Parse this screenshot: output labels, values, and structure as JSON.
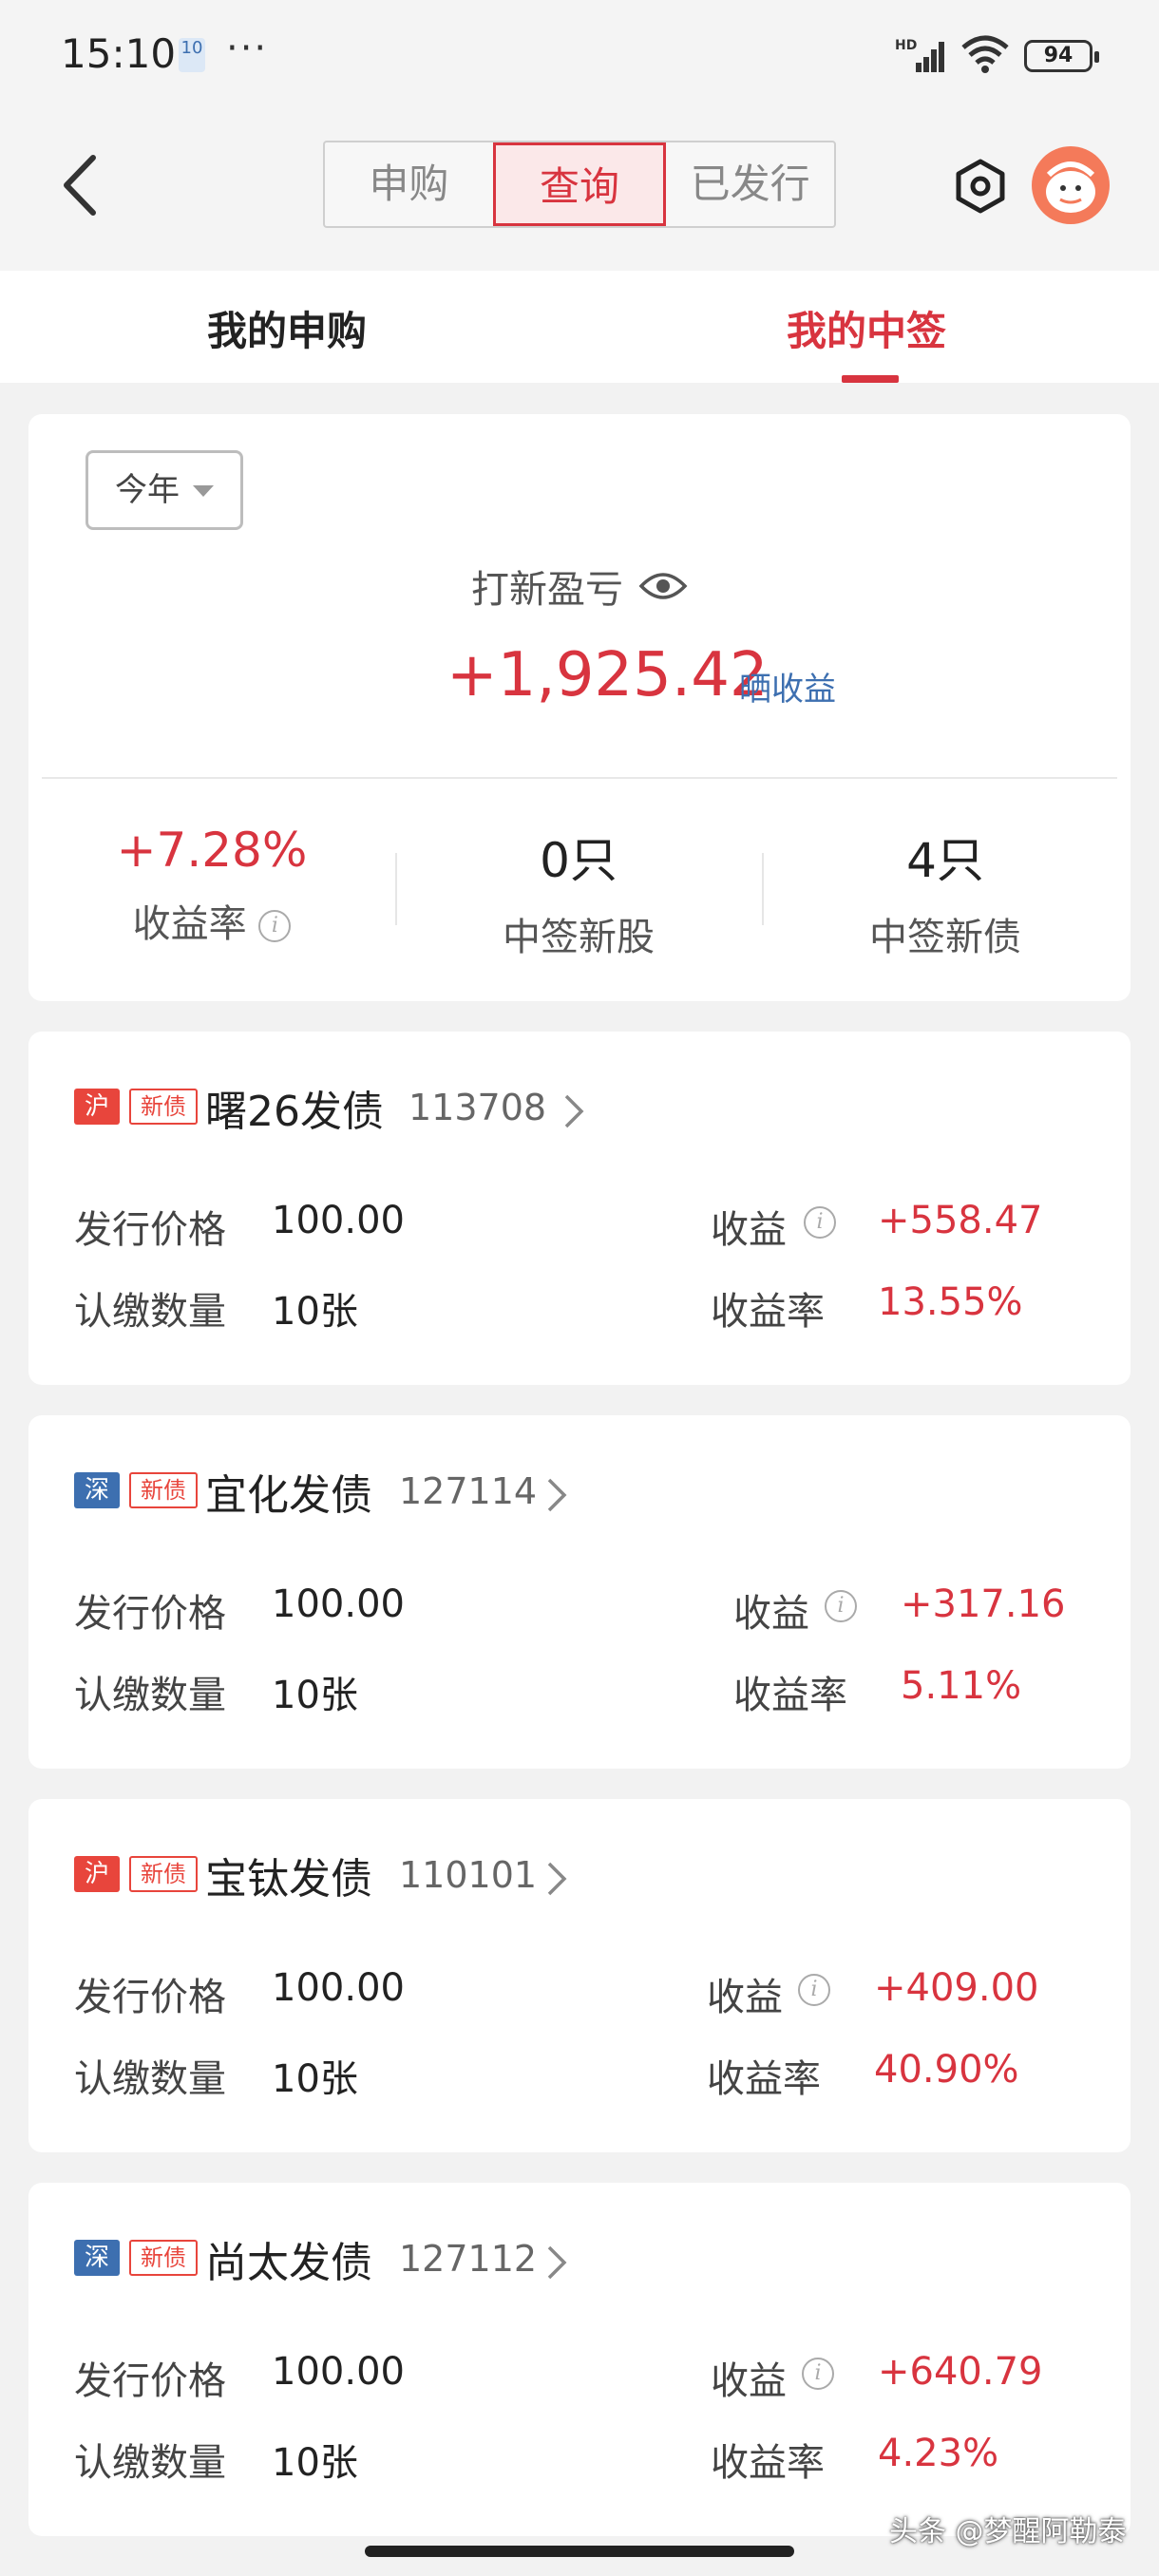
{
  "status_bar": {
    "time": "15:10",
    "notification_text": "10",
    "more": "···",
    "network": "HD",
    "battery": "94"
  },
  "nav": {
    "segments": [
      "申购",
      "查询",
      "已发行"
    ],
    "active_segment": "查询"
  },
  "tabs": {
    "tab1": "我的申购",
    "tab2": "我的中签",
    "active": "我的中签"
  },
  "summary": {
    "period": "今年",
    "pl_title": "打新盈亏",
    "pl_value": "+1,925.42",
    "share_label": "晒收益",
    "stats": [
      {
        "value": "+7.28%",
        "label": "收益率"
      },
      {
        "value": "0只",
        "label": "中签新股"
      },
      {
        "value": "4只",
        "label": "中签新债"
      }
    ],
    "accent_color": "#d8343f"
  },
  "labels": {
    "price": "发行价格",
    "qty": "认缴数量",
    "profit": "收益",
    "rate": "收益率",
    "new_bond_tag": "新债"
  },
  "bonds": [
    {
      "exchange": "沪",
      "name": "曙26发债",
      "code": "113708",
      "price": "100.00",
      "qty": "10张",
      "profit": "+558.47",
      "rate": "13.55%"
    },
    {
      "exchange": "深",
      "name": "宜化发债",
      "code": "127114",
      "price": "100.00",
      "qty": "10张",
      "profit": "+317.16",
      "rate": "5.11%"
    },
    {
      "exchange": "沪",
      "name": "宝钛发债",
      "code": "110101",
      "price": "100.00",
      "qty": "10张",
      "profit": "+409.00",
      "rate": "40.90%"
    },
    {
      "exchange": "深",
      "name": "尚太发债",
      "code": "127112",
      "price": "100.00",
      "qty": "10张",
      "profit": "+640.79",
      "rate": "4.23%"
    }
  ],
  "watermark": "头条 @梦醒阿勒泰"
}
